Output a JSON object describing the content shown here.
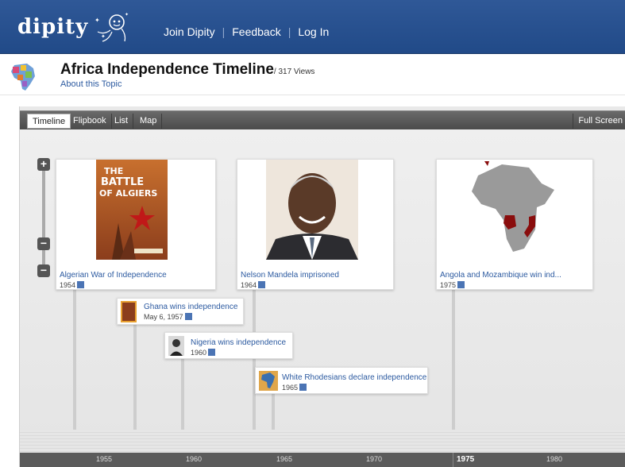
{
  "header": {
    "logo": "dipity",
    "nav": [
      "Join Dipity",
      "Feedback",
      "Log In"
    ]
  },
  "topic": {
    "title": "Africa Independence Timeline",
    "views": "/ 317 Views",
    "about": "About this Topic"
  },
  "tabs": [
    "Timeline",
    "Flipbook",
    "List",
    "Map"
  ],
  "fullscreen": "Full Screen",
  "events": [
    {
      "title": "Algerian War of Independence",
      "date": "1954",
      "image": "battle-of-algiers-poster-image"
    },
    {
      "title": "Nelson Mandela imprisoned",
      "date": "1964",
      "image": "nelson-mandela-photo-image"
    },
    {
      "title": "Angola and Mozambique win ind...",
      "date": "1975",
      "image": "africa-map-image"
    },
    {
      "title": "Ghana wins independence",
      "date": "May 6, 1957"
    },
    {
      "title": "Nigeria wins independence",
      "date": "1960"
    },
    {
      "title": "White Rhodesians declare independence",
      "date": "1965"
    }
  ],
  "poster_text": "THE BATTLE OF ALGIERS",
  "axis": {
    "ticks": [
      "1955",
      "1960",
      "1965",
      "1970",
      "1975",
      "1980"
    ],
    "current": "1975"
  },
  "colors": {
    "header": "#2a5290",
    "link": "#2c5aa0",
    "axis": "#5b5b5b"
  }
}
